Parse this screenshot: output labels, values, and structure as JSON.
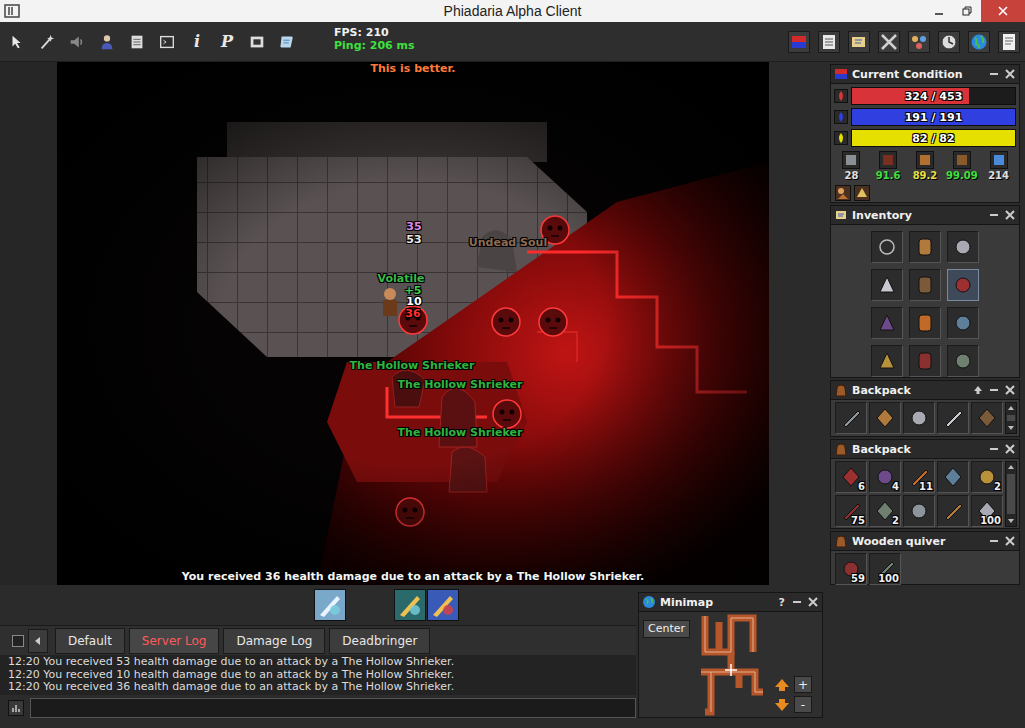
{
  "window": {
    "title": "Phiadaria Alpha Client"
  },
  "toolbar": {
    "left_icons": [
      {
        "kind": "arrow"
      },
      {
        "kind": "wand"
      },
      {
        "kind": "speaker"
      },
      {
        "kind": "person"
      },
      {
        "kind": "list"
      },
      {
        "kind": "terminal"
      },
      {
        "kind": "glyph",
        "glyph": "i"
      },
      {
        "kind": "glyph",
        "glyph": "P"
      },
      {
        "kind": "screen"
      },
      {
        "kind": "scroll"
      }
    ],
    "fps": "FPS: 210",
    "ping": "Ping: 206 ms",
    "right_icons": [
      {
        "kind": "condition"
      },
      {
        "kind": "list"
      },
      {
        "kind": "scroll"
      },
      {
        "kind": "swords"
      },
      {
        "kind": "party"
      },
      {
        "kind": "clock"
      },
      {
        "kind": "globe"
      },
      {
        "kind": "notes"
      }
    ]
  },
  "game_view": {
    "top_message": "This is better.",
    "labels": [
      {
        "text": "35",
        "color": "#d98ae8"
      },
      {
        "text": "53",
        "color": "#e8e8e8"
      },
      {
        "text": "Undead Soul",
        "color": "#8e6b52"
      },
      {
        "text": "Volatile",
        "color": "#3db84a"
      },
      {
        "text": "+5",
        "color": "#3fd04a"
      },
      {
        "text": "10",
        "color": "#ffffff"
      },
      {
        "text": "36",
        "color": "#ff3030"
      },
      {
        "text": "The Hollow Shrieker",
        "color": "#2fb53f"
      },
      {
        "text": "The Hollow Shrieker",
        "color": "#2fb53f"
      },
      {
        "text": "The Hollow Shrieker",
        "color": "#2fb53f"
      }
    ],
    "status_message": "You received 36 health damage due to an attack by a The Hollow Shrieker."
  },
  "current_condition": {
    "title": "Current Condition",
    "bars": [
      {
        "kind": "health",
        "reading": "324 / 453",
        "level": 0.715,
        "color": "#d9333a"
      },
      {
        "kind": "mana",
        "reading": "191 / 191",
        "level": 1,
        "color": "#2f3fe0"
      },
      {
        "kind": "stamina",
        "reading": "82 / 82",
        "level": 1,
        "color": "#e6e000"
      }
    ],
    "stats": [
      {
        "value": "28",
        "color": "#e0e0e0"
      },
      {
        "value": "91.6",
        "color": "#3fe03f"
      },
      {
        "value": "89.2",
        "color": "#e8e040"
      },
      {
        "value": "99.09",
        "color": "#3fe03f"
      },
      {
        "value": "214",
        "color": "#e0e0e0"
      }
    ],
    "effects": [
      {
        "kind": "haste"
      },
      {
        "kind": "buff"
      }
    ]
  },
  "inventory": {
    "title": "Inventory",
    "slots": [
      {
        "filled": false,
        "highlighted": false
      },
      {
        "filled": true,
        "highlighted": false
      },
      {
        "filled": true,
        "highlighted": false
      },
      {
        "filled": true,
        "highlighted": false
      },
      {
        "filled": true,
        "highlighted": false
      },
      {
        "filled": true,
        "highlighted": true
      },
      {
        "filled": true,
        "highlighted": false
      },
      {
        "filled": true,
        "highlighted": false
      },
      {
        "filled": true,
        "highlighted": false
      },
      {
        "filled": true,
        "highlighted": false
      },
      {
        "filled": true,
        "highlighted": false
      },
      {
        "filled": true,
        "highlighted": false
      }
    ]
  },
  "containers": [
    {
      "title": "Backpack",
      "has_up_button": true,
      "has_scrollbar": true,
      "items": [
        {},
        {},
        {},
        {},
        {}
      ]
    },
    {
      "title": "Backpack",
      "has_up_button": false,
      "has_scrollbar": true,
      "items": [
        {
          "count": "6"
        },
        {
          "count": "4"
        },
        {
          "count": "11"
        },
        {},
        {
          "count": "2"
        },
        {
          "count": "75"
        },
        {
          "count": "2"
        },
        {},
        {},
        {
          "count": "100"
        }
      ]
    },
    {
      "title": "Wooden quiver",
      "has_up_button": false,
      "has_scrollbar": false,
      "items": [
        {
          "count": "59"
        },
        {
          "count": "100"
        }
      ]
    }
  ],
  "hotbar": {
    "slots": [
      {
        "filled": true
      },
      {
        "filled": false
      },
      {
        "filled": true
      },
      {
        "filled": true
      }
    ]
  },
  "chat": {
    "tabs": [
      {
        "label": "Default",
        "selected": false
      },
      {
        "label": "Server Log",
        "selected": true
      },
      {
        "label": "Damage Log",
        "selected": false
      },
      {
        "label": "Deadbringer",
        "selected": false
      }
    ],
    "lines": [
      "12:20 You received 53 health damage due to an attack by a The Hollow Shrieker.",
      "12:20 You received 10 health damage due to an attack by a The Hollow Shrieker.",
      "12:20 You received 36 health damage due to an attack by a The Hollow Shrieker."
    ]
  },
  "minimap": {
    "title": "Minimap",
    "help": "?",
    "center_button": "Center",
    "zoom_in": "+",
    "zoom_out": "-"
  }
}
